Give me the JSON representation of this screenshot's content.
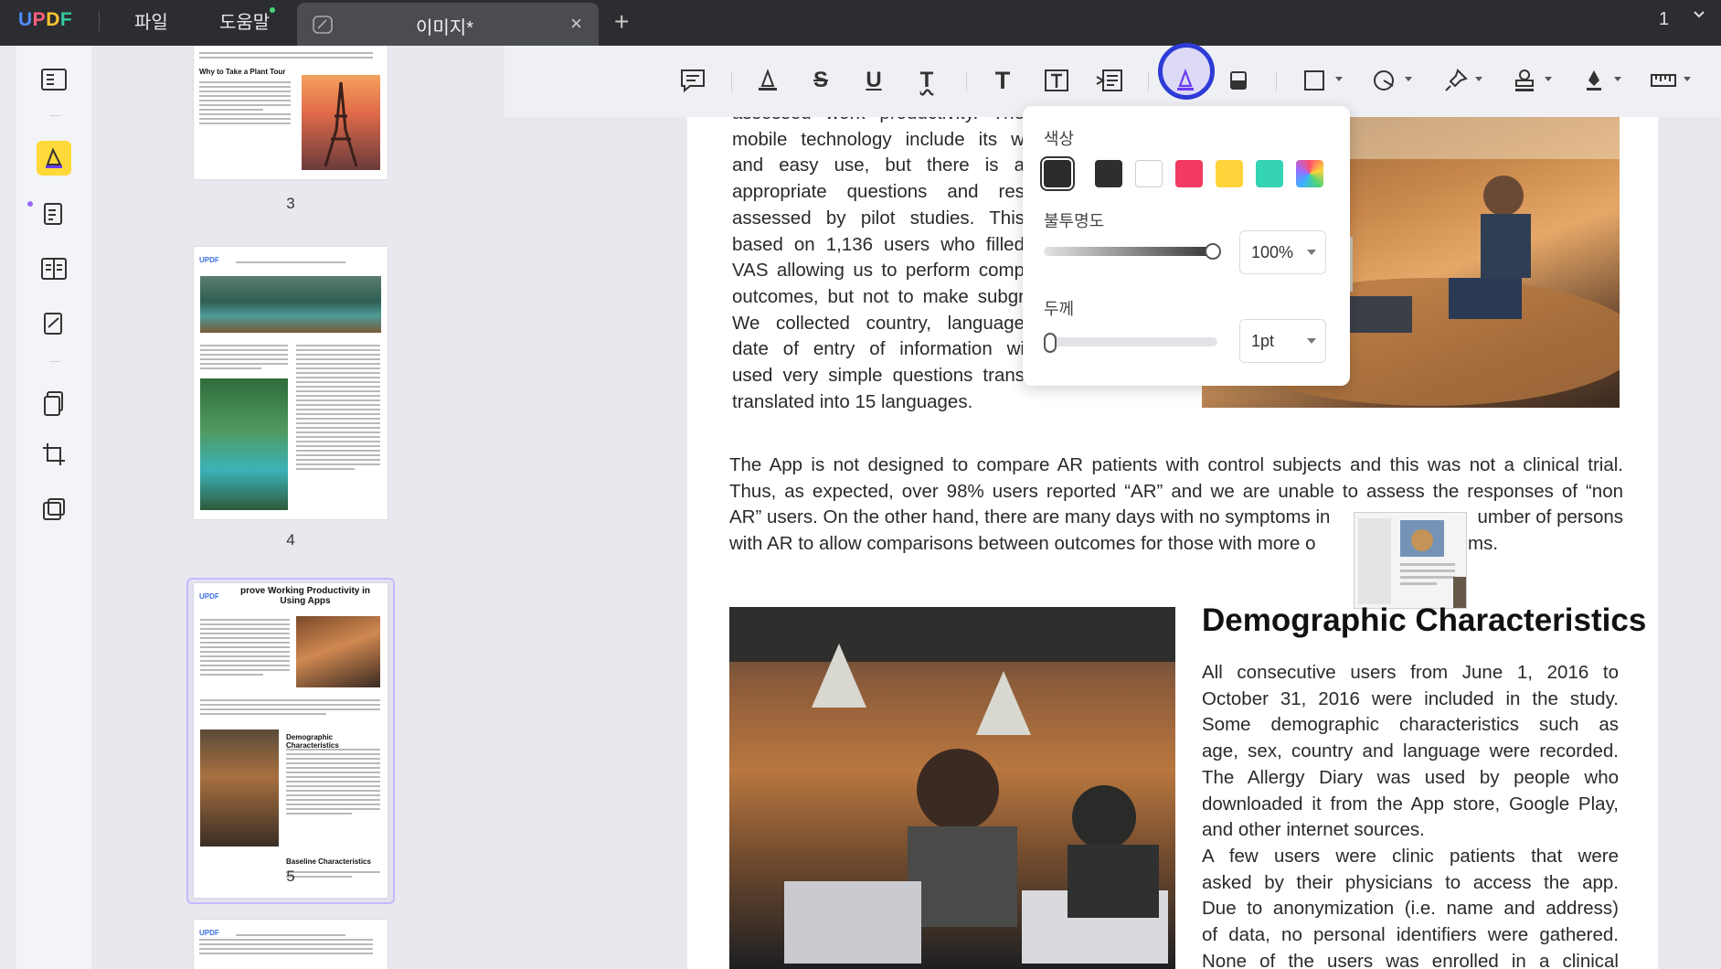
{
  "app": {
    "logo": "UPDF"
  },
  "menu": {
    "file": "파일",
    "help": "도움말"
  },
  "tab": {
    "title": "이미지*",
    "close": "×",
    "add": "+"
  },
  "page_indicator": "1",
  "thumbnails": [
    {
      "number": "3",
      "heading": "Why to Take a Plant Tour"
    },
    {
      "number": "4",
      "logo": "UPDF"
    },
    {
      "number": "5",
      "logo": "UPDF",
      "heading": "prove Working Productivity in Using Apps",
      "sub1": "Demographic Characteristics",
      "sub2": "Baseline Characteristics"
    },
    {
      "logo": "UPDF"
    }
  ],
  "toolbar": {
    "icons": [
      "comment-icon",
      "highlight-icon",
      "strikethrough-icon",
      "underline-icon",
      "squiggly-icon",
      "text-icon",
      "textbox-icon",
      "callout-icon",
      "pencil-icon",
      "eraser-icon",
      "shape-icon",
      "stamp-shape-icon",
      "pin-icon",
      "stamp-icon",
      "signature-icon",
      "ruler-icon"
    ],
    "labels": {
      "strike": "S",
      "underline": "U",
      "squiggly": "T",
      "text": "T"
    }
  },
  "popover": {
    "color_label": "색상",
    "colors": [
      "#2b2b2b",
      "#2e2e2e",
      "#ffffff",
      "#f23a62",
      "#ffd43b",
      "#35d3b5",
      "rainbow"
    ],
    "selected_color": "#2b2b2b",
    "opacity_label": "불투명도",
    "opacity_value": "100%",
    "opacity_level": 1.0,
    "thickness_label": "두께",
    "thickness_value": "1pt",
    "thickness_level": 0.0
  },
  "document": {
    "para1_lines": [
      "assessed work productivity. The",
      "mobile technology include its w",
      "and easy use, but there is a",
      "appropriate questions and res",
      "assessed by pilot studies. This",
      "based on 1,136 users who filled",
      "VAS allowing us to perform comp",
      "outcomes, but not to make subgr",
      "We collected country, language",
      "date of entry of information wi",
      "used very simple questions trans",
      "translated into 15 languages."
    ],
    "para2_lines": [
      "The App is not designed to compare AR patients with control subjects and this was not a clinical trial.",
      "Thus, as expected, over 98% users reported “AR” and we are unable to assess the responses of “non",
      "AR” users. On the other hand, there are many days with no symptoms in",
      "umber of persons",
      "with AR to allow comparisons between outcomes for those with more o",
      "ms."
    ],
    "heading": "Demographic Characteristics",
    "para3_lines": [
      "All consecutive users from June 1, 2016 to",
      "October 31, 2016 were included in the study.",
      "Some demographic characteristics such as",
      "age, sex, country and language were recorded.",
      "The Allergy Diary was used by people who",
      "downloaded it from the App store, Google Play,",
      "and other internet sources.",
      "A few users were clinic patients that were",
      "asked by their physicians to access the app.",
      "Due to anonymization (i.e. name and address)",
      "of data, no personal identifiers were gathered.",
      "None of the users was enrolled in a clinical"
    ]
  }
}
